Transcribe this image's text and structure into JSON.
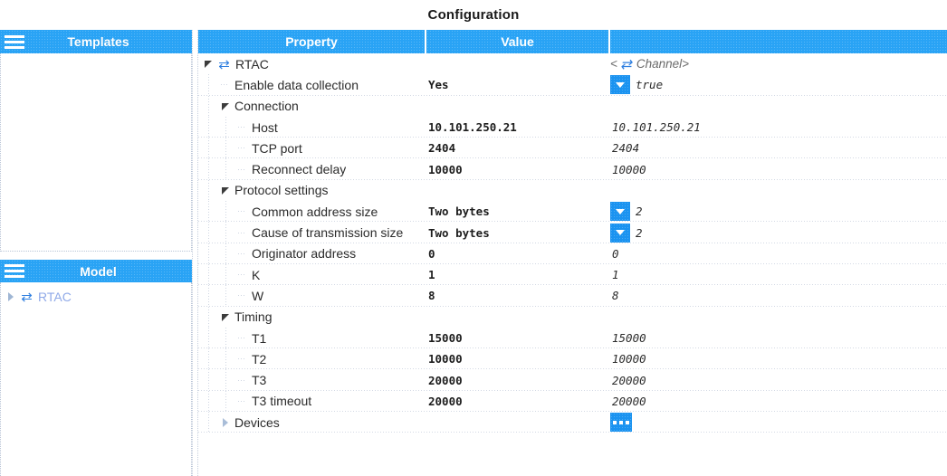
{
  "app": {
    "title": "Configuration"
  },
  "colors": {
    "header_blue": "#29a3f5",
    "button_blue": "#1b93f0",
    "tree_link": "#8fa9e8",
    "icon_blue": "#2f7fe0",
    "text": "#2b2b2b"
  },
  "templates_panel": {
    "title": "Templates",
    "menu_icon": "hamburger-icon",
    "items": []
  },
  "model_panel": {
    "title": "Model",
    "menu_icon": "hamburger-icon",
    "nodes": [
      {
        "label": "RTAC",
        "icon": "exchange-icon",
        "expander": "collapsed",
        "glyph": "⇄"
      }
    ]
  },
  "grid": {
    "columns": [
      {
        "label": "Property"
      },
      {
        "label": "Value"
      },
      {
        "label": ""
      }
    ],
    "rows": [
      {
        "property": "RTAC",
        "value": "",
        "extra": "<⇄ Channel>",
        "indent": 0,
        "expander": "expanded",
        "icon": "exchange-icon",
        "editor": "none",
        "extra_kind": "channel"
      },
      {
        "property": "Enable data collection",
        "value": "Yes",
        "extra": "true",
        "indent": 1,
        "expander": "leaf",
        "editor": "dropdown"
      },
      {
        "property": "Connection",
        "value": "",
        "extra": "",
        "indent": 1,
        "expander": "expanded",
        "editor": "none"
      },
      {
        "property": "Host",
        "value": "10.101.250.21",
        "extra": "10.101.250.21",
        "indent": 2,
        "expander": "leaf",
        "editor": "none"
      },
      {
        "property": "TCP port",
        "value": "2404",
        "extra": "2404",
        "indent": 2,
        "expander": "leaf",
        "editor": "none"
      },
      {
        "property": "Reconnect delay",
        "value": "10000",
        "extra": "10000",
        "indent": 2,
        "expander": "leaf",
        "editor": "none"
      },
      {
        "property": "Protocol settings",
        "value": "",
        "extra": "",
        "indent": 1,
        "expander": "expanded",
        "editor": "none"
      },
      {
        "property": "Common address size",
        "value": "Two bytes",
        "extra": "2",
        "indent": 2,
        "expander": "leaf",
        "editor": "dropdown"
      },
      {
        "property": "Cause of transmission size",
        "value": "Two bytes",
        "extra": "2",
        "indent": 2,
        "expander": "leaf",
        "editor": "dropdown"
      },
      {
        "property": "Originator address",
        "value": "0",
        "extra": "0",
        "indent": 2,
        "expander": "leaf",
        "editor": "none"
      },
      {
        "property": "K",
        "value": "1",
        "extra": "1",
        "indent": 2,
        "expander": "leaf",
        "editor": "none"
      },
      {
        "property": "W",
        "value": "8",
        "extra": "8",
        "indent": 2,
        "expander": "leaf",
        "editor": "none"
      },
      {
        "property": "Timing",
        "value": "",
        "extra": "",
        "indent": 1,
        "expander": "expanded",
        "editor": "none"
      },
      {
        "property": "T1",
        "value": "15000",
        "extra": "15000",
        "indent": 2,
        "expander": "leaf",
        "editor": "none"
      },
      {
        "property": "T2",
        "value": "10000",
        "extra": "10000",
        "indent": 2,
        "expander": "leaf",
        "editor": "none"
      },
      {
        "property": "T3",
        "value": "20000",
        "extra": "20000",
        "indent": 2,
        "expander": "leaf",
        "editor": "none"
      },
      {
        "property": "T3 timeout",
        "value": "20000",
        "extra": "20000",
        "indent": 2,
        "expander": "leaf",
        "editor": "none"
      },
      {
        "property": "Devices",
        "value": "",
        "extra": "",
        "indent": 1,
        "expander": "collapsed",
        "editor": "ellipsis"
      }
    ]
  }
}
